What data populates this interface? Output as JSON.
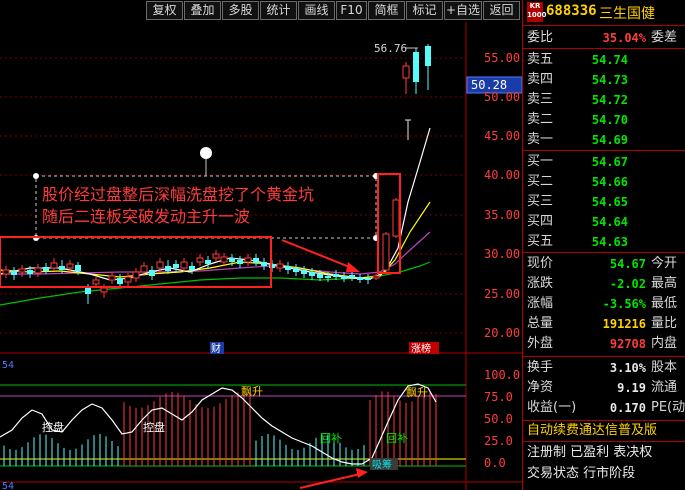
{
  "toolbar": {
    "buttons": [
      "复权",
      "叠加",
      "多股",
      "统计",
      "画线",
      "F10",
      "简框",
      "标记",
      "+自选",
      "返回"
    ]
  },
  "stock": {
    "badge_top": "KR",
    "badge_bottom": "1000",
    "code": "688336",
    "name": "三生国健"
  },
  "chart": {
    "y_ticks": [
      "55.00",
      "50.00",
      "45.00",
      "40.00",
      "35.00",
      "30.00",
      "25.00",
      "20.00"
    ],
    "current_price_tag": "50.28",
    "high_label": "56.76",
    "indicator_ticks": [
      "100.0",
      "75.0",
      "50.0",
      "25.0",
      "0.0"
    ],
    "indicator_period": "54",
    "bottom_period": "54",
    "annotation_line1": "股价经过盘整后深幅洗盘挖了个黄金坑",
    "annotation_line2": "随后二连板突破发动主升一波",
    "event_cai": "财",
    "event_zhangbang": "涨榜",
    "tag_piaosheng_1": "飘升",
    "tag_piaosheng_2": "飘升",
    "tag_kongpan_1": "控盘",
    "tag_kongpan_2": "控盘",
    "tag_huibu_1": "回补",
    "tag_huibu_2": "回补",
    "tag_shachou": "吸筹",
    "colors": {
      "up": "#ff3c3c",
      "down": "#54fcfc",
      "ma_short": "#ffffff",
      "ma_mid": "#ffff00",
      "ma_long": "#c040c0",
      "ma_xlong": "#00c000",
      "grid": "#8b0000"
    }
  },
  "quote": {
    "weibi_label": "委比",
    "weibi_value": "35.04%",
    "weicha_label": "委差",
    "sells": [
      {
        "label": "卖五",
        "price": "54.74"
      },
      {
        "label": "卖四",
        "price": "54.73"
      },
      {
        "label": "卖三",
        "price": "54.72"
      },
      {
        "label": "卖二",
        "price": "54.70"
      },
      {
        "label": "卖一",
        "price": "54.69"
      }
    ],
    "buys": [
      {
        "label": "买一",
        "price": "54.67"
      },
      {
        "label": "买二",
        "price": "54.66"
      },
      {
        "label": "买三",
        "price": "54.65"
      },
      {
        "label": "买四",
        "price": "54.64"
      },
      {
        "label": "买五",
        "price": "54.63"
      }
    ],
    "stats": [
      {
        "label": "现价",
        "value": "54.67",
        "label2": "今开",
        "color": "green"
      },
      {
        "label": "涨跌",
        "value": "-2.02",
        "label2": "最高",
        "color": "green"
      },
      {
        "label": "涨幅",
        "value": "-3.56%",
        "label2": "最低",
        "color": "green"
      },
      {
        "label": "总量",
        "value": "191216",
        "label2": "量比",
        "color": "yellow"
      },
      {
        "label": "外盘",
        "value": "92708",
        "label2": "内盘",
        "color": "red"
      }
    ],
    "stats2": [
      {
        "label": "换手",
        "value": "3.10%",
        "label2": "股本",
        "color": "white"
      },
      {
        "label": "净资",
        "value": "9.19",
        "label2": "流通",
        "color": "white"
      },
      {
        "label": "收益(一)",
        "value": "0.170",
        "label2": "PE(动",
        "color": "white"
      }
    ],
    "promo1": "自动续费通达信普及版",
    "promo2": "注册制 已盈利 表决权",
    "promo3": "交易状态 行市阶段"
  }
}
